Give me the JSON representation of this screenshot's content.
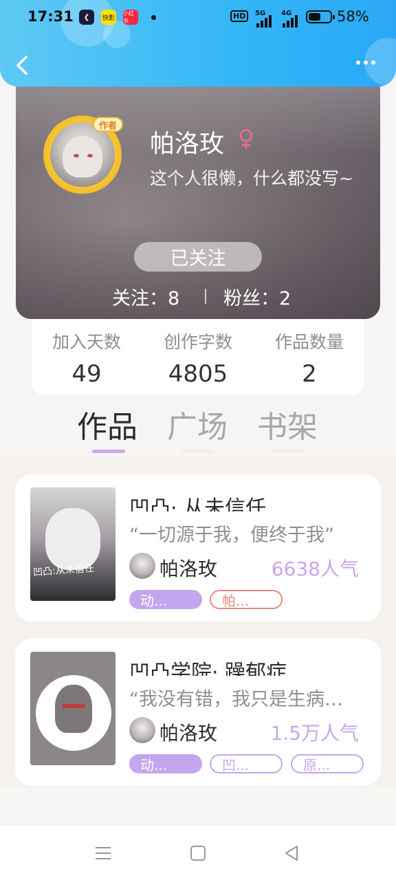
{
  "status_bar": {
    "time": "17:31",
    "app_icons": [
      "kuaishou-lite-icon",
      "kuaikan-icon",
      "xiaohongshu-icon"
    ],
    "app_icon_labels": [
      "快影",
      "小红书"
    ],
    "hd_label": "HD",
    "network_1": "5G",
    "network_2": "4G",
    "battery_percent": "58%",
    "battery_level": 0.58
  },
  "header": {
    "back_icon": "chevron-left-icon",
    "more_icon": "more-dots-icon"
  },
  "profile": {
    "badge": "作者",
    "name": "帕洛玫",
    "gender_icon": "female-icon",
    "bio": "这个人很懒，什么都没写~",
    "follow_button": "已关注",
    "following": "关注：8",
    "followers": "粉丝：2"
  },
  "stats": [
    {
      "label": "加入天数",
      "value": "49"
    },
    {
      "label": "创作字数",
      "value": "4805"
    },
    {
      "label": "作品数量",
      "value": "2"
    }
  ],
  "tabs": [
    {
      "label": "作品",
      "active": true
    },
    {
      "label": "广场",
      "active": false
    },
    {
      "label": "书架",
      "active": false
    }
  ],
  "works": [
    {
      "title": "凹凸· 从未信任",
      "cover_text": "凹凸:从未信任",
      "description": "“一切源于我，便终于我”",
      "author": "帕洛玫",
      "popularity": "6638人气",
      "tags": [
        "动...",
        "帕..."
      ]
    },
    {
      "title": "凹凸学院· 躁郁症",
      "description": "“我没有错，我只是生病…",
      "author": "帕洛玫",
      "popularity": "1.5万人气",
      "tags": [
        "动...",
        "凹...",
        "原..."
      ]
    }
  ],
  "colors": {
    "header_blue": "#33b6f7",
    "accent_purple": "#c4a6ee",
    "tag_red": "#e08a84",
    "gender_pink": "#f06e8e"
  },
  "nav": {
    "icons": [
      "menu-icon",
      "home-square-icon",
      "back-triangle-icon"
    ]
  }
}
